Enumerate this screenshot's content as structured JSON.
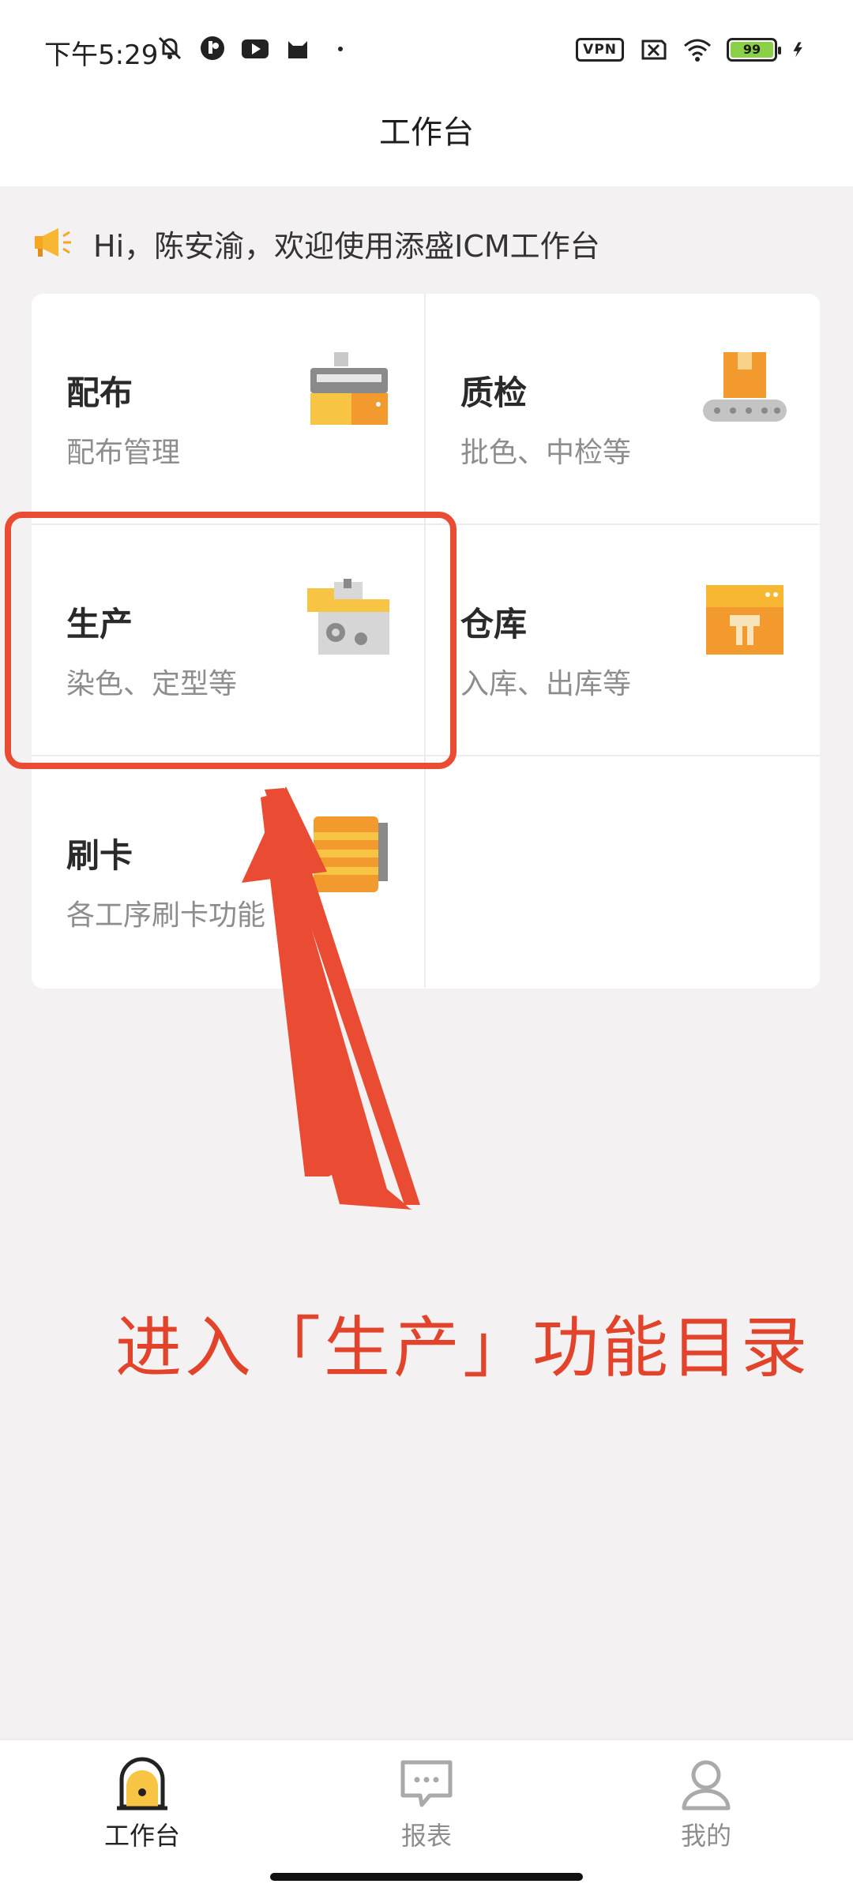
{
  "status_bar": {
    "time": "下午5:29",
    "vpn_label": "VPN",
    "battery_level": "99"
  },
  "header": {
    "title": "工作台"
  },
  "notice": {
    "text": "Hi，陈安渝，欢迎使用添盛ICM工作台"
  },
  "grid": {
    "items": [
      {
        "title": "配布",
        "subtitle": "配布管理",
        "icon": "fabric-machine-icon"
      },
      {
        "title": "质检",
        "subtitle": "批色、中检等",
        "icon": "conveyor-box-icon"
      },
      {
        "title": "生产",
        "subtitle": "染色、定型等",
        "icon": "production-machine-icon"
      },
      {
        "title": "仓库",
        "subtitle": "入库、出库等",
        "icon": "warehouse-box-icon"
      },
      {
        "title": "刷卡",
        "subtitle": "各工序刷卡功能",
        "icon": "card-reader-icon"
      }
    ]
  },
  "annotation": {
    "text": "进入「生产」功能目录",
    "color": "#e2442b"
  },
  "bottom_nav": {
    "items": [
      {
        "label": "工作台",
        "active": true
      },
      {
        "label": "报表",
        "active": false
      },
      {
        "label": "我的",
        "active": false
      }
    ]
  },
  "colors": {
    "accent": "#f5a623",
    "annotation": "#e94b33"
  }
}
